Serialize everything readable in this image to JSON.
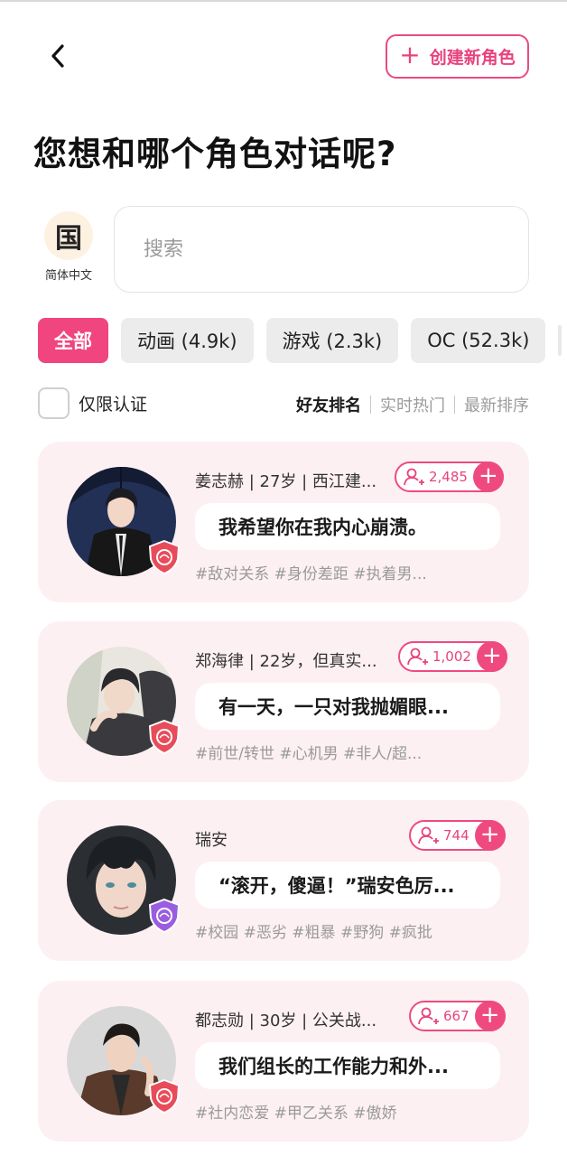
{
  "header": {
    "create_label": "创建新角色",
    "title": "您想和哪个角色对话呢?"
  },
  "language": {
    "glyph": "国",
    "label": "简体中文"
  },
  "search": {
    "placeholder": "搜索"
  },
  "filters": [
    {
      "label": "全部",
      "active": true
    },
    {
      "label": "动画 (4.9k)",
      "active": false
    },
    {
      "label": "游戏 (2.3k)",
      "active": false
    },
    {
      "label": "OC (52.3k)",
      "active": false
    }
  ],
  "verified": {
    "label": "仅限认证",
    "checked": false
  },
  "sort": [
    {
      "label": "好友排名",
      "active": true
    },
    {
      "label": "实时热门",
      "active": false
    },
    {
      "label": "最新排序",
      "active": false
    }
  ],
  "accent_color": "#f0457f",
  "characters": [
    {
      "meta": "姜志赫 | 27岁 | 西江建...",
      "followers": "2,485",
      "quote": "我希望你在我内心崩溃。",
      "tags": "#敌对关系 #身份差距 #执着男...",
      "badge": "red-shield-icon"
    },
    {
      "meta": "郑海律 | 22岁，但真实...",
      "followers": "1,002",
      "quote": "有一天，一只对我抛媚眼...",
      "tags": "#前世/转世 #心机男 #非人/超...",
      "badge": "red-shield-icon"
    },
    {
      "meta": "瑞安",
      "followers": "744",
      "quote": "“滚开，傻逼！”瑞安色厉...",
      "tags": "#校园 #恶劣 #粗暴 #野狗 #疯批",
      "badge": "purple-shield-icon"
    },
    {
      "meta": "都志勋 | 30岁 | 公关战...",
      "followers": "667",
      "quote": "我们组长的工作能力和外...",
      "tags": "#社内恋爱 #甲乙关系 #傲娇",
      "badge": "red-shield-icon"
    }
  ]
}
